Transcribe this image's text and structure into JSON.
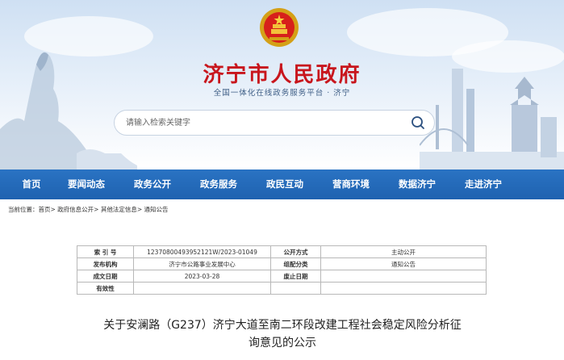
{
  "site": {
    "name": "济宁市人民政府",
    "subtitle": "全国一体化在线政务服务平台 · 济宁"
  },
  "search": {
    "placeholder": "请输入检索关键字"
  },
  "nav": [
    "首页",
    "要闻动态",
    "政务公开",
    "政务服务",
    "政民互动",
    "营商环境",
    "数据济宁",
    "走进济宁"
  ],
  "breadcrumb": "当前位置：首页> 政府信息公开> 其他法定信息> 通知公告",
  "meta": {
    "index_label": "索 引 号",
    "index_value": "12370800493952121W/2023-01049",
    "disclosure_label": "公开方式",
    "disclosure_value": "主动公开",
    "issuer_label": "发布机构",
    "issuer_value": "济宁市公路事业发展中心",
    "category_label": "组配分类",
    "category_value": "通知公告",
    "date_label": "成文日期",
    "date_value": "2023-03-28",
    "expiry_label": "废止日期",
    "expiry_value": "",
    "validity_label": "有效性",
    "validity_value": ""
  },
  "article": {
    "title_line1": "关于安澜路（G237）济宁大道至南二环段改建工程社会稳定风险分析征",
    "title_line2": "询意见的公示"
  },
  "colors": {
    "brand_red": "#c8161d",
    "nav_blue": "#1f62b0"
  }
}
